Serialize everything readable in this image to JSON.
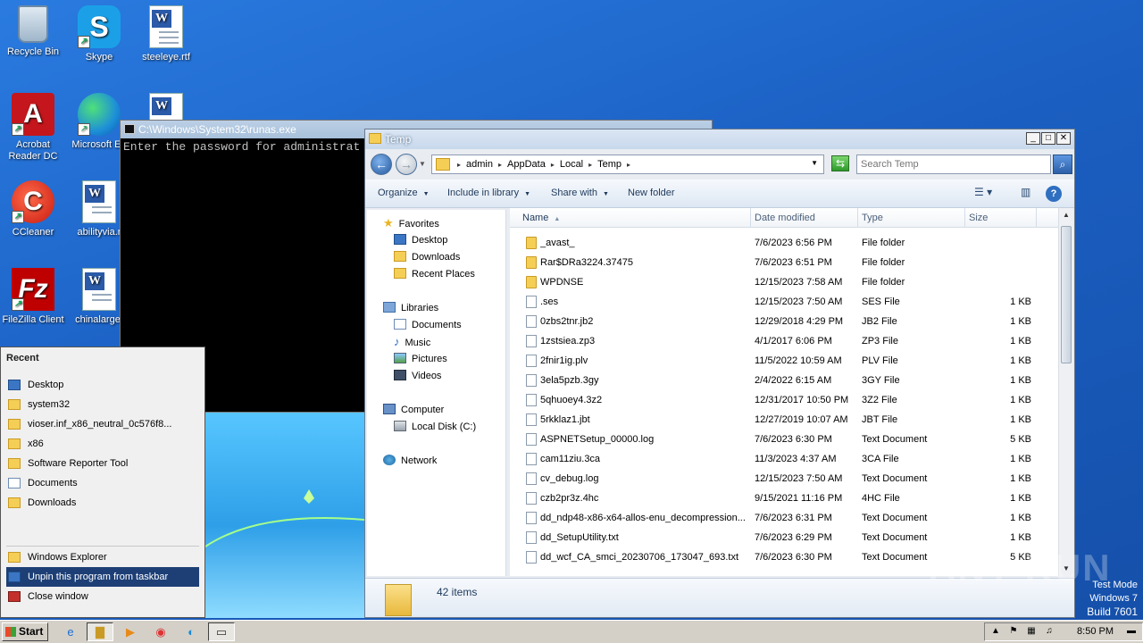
{
  "desktop": {
    "icons": [
      {
        "label": "Recycle Bin"
      },
      {
        "label": "Skype"
      },
      {
        "label": "steeleye.rtf"
      },
      {
        "label": "Acrobat Reader DC"
      },
      {
        "label": "Microsoft Ed"
      },
      {
        "label": "CCleaner"
      },
      {
        "label": "abilityvia.r"
      },
      {
        "label": "FileZilla Client"
      },
      {
        "label": "chinalarge."
      }
    ]
  },
  "console": {
    "title": "C:\\Windows\\System32\\runas.exe",
    "text": "Enter the password for administrat"
  },
  "explorer": {
    "title": "Temp",
    "breadcrumbs": [
      "admin",
      "AppData",
      "Local",
      "Temp"
    ],
    "search_placeholder": "Search Temp",
    "commands": {
      "organize": "Organize",
      "include": "Include in library",
      "share": "Share with",
      "newfolder": "New folder"
    },
    "nav": {
      "favorites": "Favorites",
      "desktop": "Desktop",
      "downloads": "Downloads",
      "recent": "Recent Places",
      "libraries": "Libraries",
      "documents": "Documents",
      "music": "Music",
      "pictures": "Pictures",
      "videos": "Videos",
      "computer": "Computer",
      "localdisk": "Local Disk (C:)",
      "network": "Network"
    },
    "columns": {
      "name": "Name",
      "date": "Date modified",
      "type": "Type",
      "size": "Size"
    },
    "files": [
      {
        "name": "_avast_",
        "date": "7/6/2023 6:56 PM",
        "type": "File folder",
        "size": "",
        "kind": "folder"
      },
      {
        "name": "Rar$DRa3224.37475",
        "date": "7/6/2023 6:51 PM",
        "type": "File folder",
        "size": "",
        "kind": "folder"
      },
      {
        "name": "WPDNSE",
        "date": "12/15/2023 7:58 AM",
        "type": "File folder",
        "size": "",
        "kind": "folder"
      },
      {
        "name": ".ses",
        "date": "12/15/2023 7:50 AM",
        "type": "SES File",
        "size": "1 KB",
        "kind": "file"
      },
      {
        "name": "0zbs2tnr.jb2",
        "date": "12/29/2018 4:29 PM",
        "type": "JB2 File",
        "size": "1 KB",
        "kind": "file"
      },
      {
        "name": "1zstsiea.zp3",
        "date": "4/1/2017 6:06 PM",
        "type": "ZP3 File",
        "size": "1 KB",
        "kind": "file"
      },
      {
        "name": "2fnir1ig.plv",
        "date": "11/5/2022 10:59 AM",
        "type": "PLV File",
        "size": "1 KB",
        "kind": "file"
      },
      {
        "name": "3ela5pzb.3gy",
        "date": "2/4/2022 6:15 AM",
        "type": "3GY File",
        "size": "1 KB",
        "kind": "file"
      },
      {
        "name": "5qhuoey4.3z2",
        "date": "12/31/2017 10:50 PM",
        "type": "3Z2 File",
        "size": "1 KB",
        "kind": "file"
      },
      {
        "name": "5rkklaz1.jbt",
        "date": "12/27/2019 10:07 AM",
        "type": "JBT File",
        "size": "1 KB",
        "kind": "file"
      },
      {
        "name": "ASPNETSetup_00000.log",
        "date": "7/6/2023 6:30 PM",
        "type": "Text Document",
        "size": "5 KB",
        "kind": "file"
      },
      {
        "name": "cam11ziu.3ca",
        "date": "11/3/2023 4:37 AM",
        "type": "3CA File",
        "size": "1 KB",
        "kind": "file"
      },
      {
        "name": "cv_debug.log",
        "date": "12/15/2023 7:50 AM",
        "type": "Text Document",
        "size": "1 KB",
        "kind": "file"
      },
      {
        "name": "czb2pr3z.4hc",
        "date": "9/15/2021 11:16 PM",
        "type": "4HC File",
        "size": "1 KB",
        "kind": "file"
      },
      {
        "name": "dd_ndp48-x86-x64-allos-enu_decompression...",
        "date": "7/6/2023 6:31 PM",
        "type": "Text Document",
        "size": "1 KB",
        "kind": "file"
      },
      {
        "name": "dd_SetupUtility.txt",
        "date": "7/6/2023 6:29 PM",
        "type": "Text Document",
        "size": "1 KB",
        "kind": "file"
      },
      {
        "name": "dd_wcf_CA_smci_20230706_173047_693.txt",
        "date": "7/6/2023 6:30 PM",
        "type": "Text Document",
        "size": "5 KB",
        "kind": "file"
      }
    ],
    "status": "42 items"
  },
  "jumplist": {
    "heading": "Recent",
    "recent": [
      "Desktop",
      "system32",
      "vioser.inf_x86_neutral_0c576f8...",
      "x86",
      "Software Reporter Tool",
      "Documents",
      "Downloads"
    ],
    "tasks": [
      "Windows Explorer",
      "Unpin this program from taskbar",
      "Close window"
    ]
  },
  "taskbar": {
    "start": "Start",
    "clock": "8:50 PM"
  },
  "overlay": {
    "watermark": "ANY RUN",
    "testmode": "Test Mode",
    "os": "Windows 7",
    "build": "Build 7601"
  }
}
